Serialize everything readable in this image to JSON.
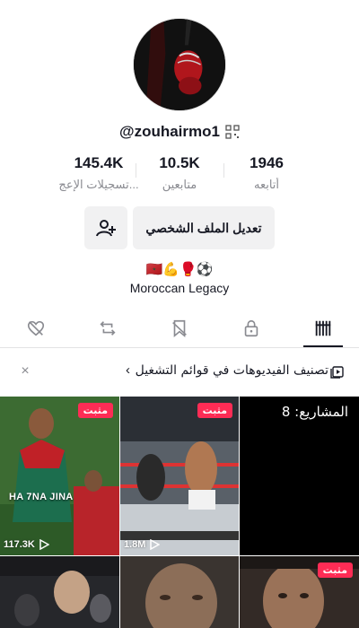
{
  "profile": {
    "username": "@zouhairmo1",
    "stats": [
      {
        "value": "145.4K",
        "label": "تسجيلات الإعج..."
      },
      {
        "value": "10.5K",
        "label": "متابعين"
      },
      {
        "value": "1946",
        "label": "أتابعه"
      }
    ],
    "edit_profile_label": "تعديل الملف الشخصي",
    "bio_emojis": "🇲🇦💪🥊⚽",
    "bio_text": "Moroccan Legacy"
  },
  "tabs": [
    {
      "icon": "liked-hidden-icon"
    },
    {
      "icon": "repost-icon"
    },
    {
      "icon": "favorites-hidden-icon"
    },
    {
      "icon": "lock-icon"
    },
    {
      "icon": "grid-videos-icon",
      "active": true
    }
  ],
  "playlist_banner": {
    "text": "تصنيف الفيديوهات في قوائم التشغيل",
    "chevron": "‹",
    "close": "×"
  },
  "videos": [
    {
      "pinned_label": "مثبت",
      "views": "117.3K",
      "caption": "HA 7NA JINA"
    },
    {
      "pinned_label": "مثبت",
      "views": "1.8M"
    },
    {
      "projects_label": "المشاريع: 8"
    },
    {},
    {},
    {
      "pinned_label": "مثبت"
    }
  ],
  "colors": {
    "accent": "#fe2c55",
    "text": "#161823",
    "muted": "#8a8b91",
    "button_bg": "#f1f1f2"
  }
}
